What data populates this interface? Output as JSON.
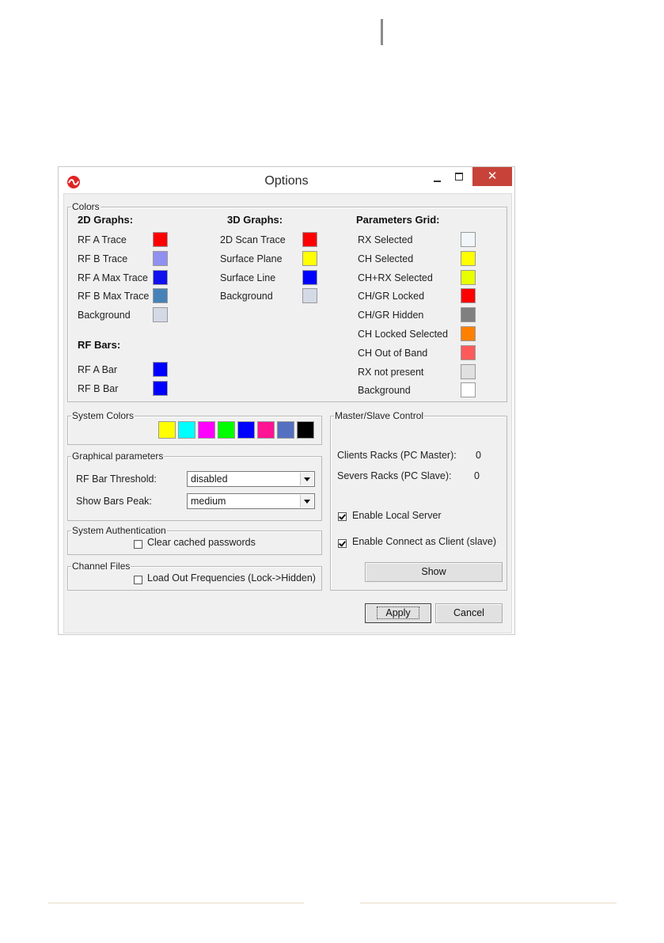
{
  "window": {
    "title": "Options",
    "close_glyph": "✕"
  },
  "colors_group": {
    "legend": "Colors",
    "graphs2d": {
      "header": "2D Graphs:",
      "items": [
        {
          "label": "RF A Trace",
          "color": "#ff0000"
        },
        {
          "label": "RF B Trace",
          "color": "#9090f0"
        },
        {
          "label": "RF A Max Trace",
          "color": "#1010ee"
        },
        {
          "label": "RF B Max Trace",
          "color": "#4682b8"
        },
        {
          "label": "Background",
          "color": "#d4d9e6"
        }
      ]
    },
    "rfbars": {
      "header": "RF Bars:",
      "items": [
        {
          "label": "RF A Bar",
          "color": "#0000ff"
        },
        {
          "label": "RF B Bar",
          "color": "#0000ff"
        }
      ]
    },
    "graphs3d": {
      "header": "3D Graphs:",
      "items": [
        {
          "label": "2D Scan Trace",
          "color": "#ff0000"
        },
        {
          "label": "Surface Plane",
          "color": "#ffff00"
        },
        {
          "label": "Surface Line",
          "color": "#0000ff"
        },
        {
          "label": "Background",
          "color": "#d4d9e6"
        }
      ]
    },
    "params": {
      "header": "Parameters Grid:",
      "items": [
        {
          "label": "RX Selected",
          "color": "#f0f6fa"
        },
        {
          "label": "CH Selected",
          "color": "#ffff00"
        },
        {
          "label": "CH+RX Selected",
          "color": "#e8ff00"
        },
        {
          "label": "CH/GR Locked",
          "color": "#ff0000"
        },
        {
          "label": "CH/GR Hidden",
          "color": "#808080"
        },
        {
          "label": "CH Locked Selected",
          "color": "#ff8000"
        },
        {
          "label": "CH Out of Band",
          "color": "#ff5a5a"
        },
        {
          "label": "RX not present",
          "color": "#e0e0e0"
        },
        {
          "label": "Background",
          "color": "#ffffff"
        }
      ]
    }
  },
  "system_colors": {
    "legend": "System Colors",
    "swatches": [
      "#ffff00",
      "#00ffff",
      "#ff00ff",
      "#00ff00",
      "#0000ff",
      "#ff1493",
      "#5570c0",
      "#000000"
    ]
  },
  "graphical": {
    "legend": "Graphical parameters",
    "threshold_label": "RF Bar Threshold:",
    "threshold_value": "disabled",
    "peak_label": "Show Bars Peak:",
    "peak_value": "medium"
  },
  "auth": {
    "legend": "System Authentication",
    "clear_label": "Clear cached passwords",
    "clear_checked": false
  },
  "channel_files": {
    "legend": "Channel Files",
    "load_label": "Load Out Frequencies (Lock->Hidden)",
    "load_checked": false
  },
  "master_slave": {
    "legend": "Master/Slave Control",
    "clients_label": "Clients Racks (PC Master):",
    "clients_value": "0",
    "severs_label": "Severs Racks (PC Slave):",
    "severs_value": "0",
    "enable_local_label": "Enable Local Server",
    "enable_local_checked": true,
    "enable_client_label": "Enable Connect as Client (slave)",
    "enable_client_checked": true,
    "show_label": "Show"
  },
  "footer": {
    "apply_label": "Apply",
    "cancel_label": "Cancel"
  }
}
